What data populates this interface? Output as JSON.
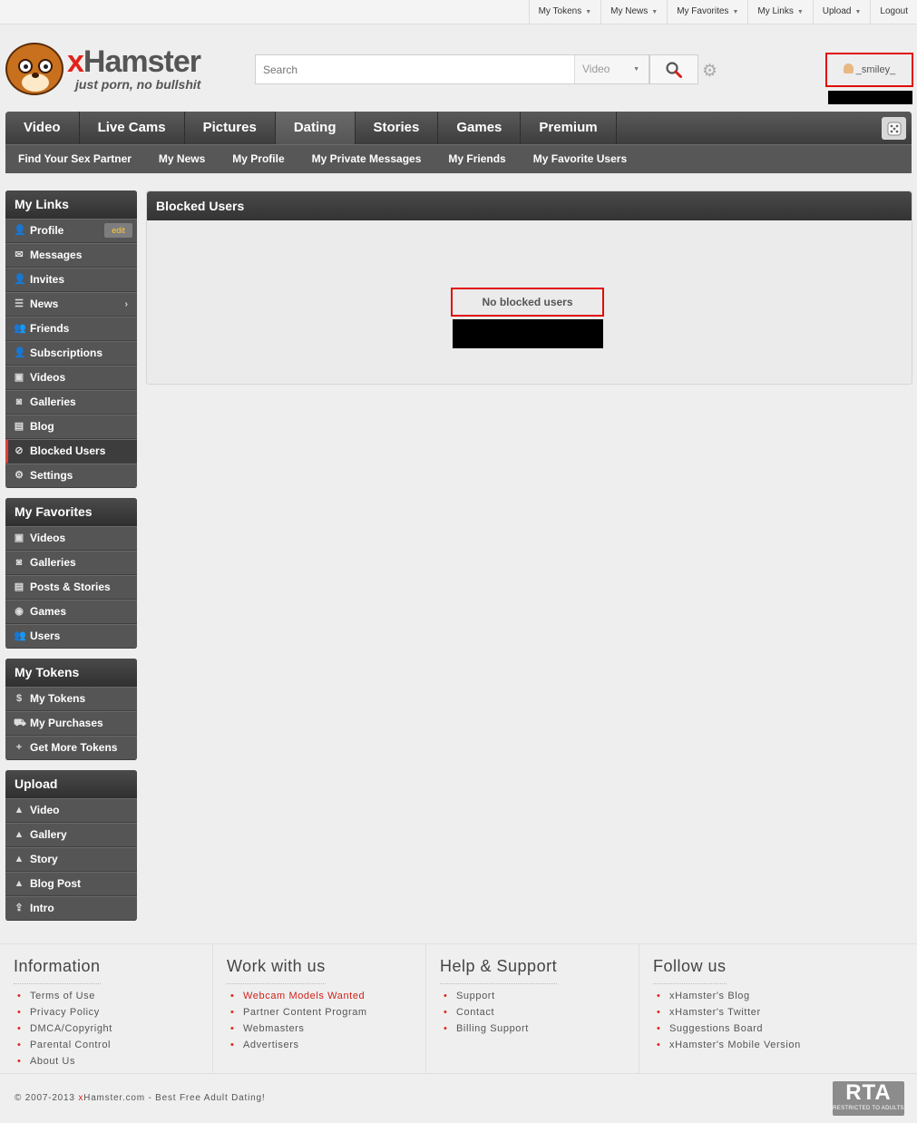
{
  "topbar": {
    "items": [
      {
        "label": "My Tokens",
        "caret": true
      },
      {
        "label": "My News",
        "caret": true
      },
      {
        "label": "My Favorites",
        "caret": true
      },
      {
        "label": "My Links",
        "caret": true
      },
      {
        "label": "Upload",
        "caret": true
      },
      {
        "label": "Logout",
        "caret": false
      }
    ]
  },
  "header": {
    "logo_x": "x",
    "logo_name": "Hamster",
    "logo_tagline": "just porn, no bullshit",
    "search_placeholder": "Search",
    "search_scope": "Video",
    "username": "_smiley_"
  },
  "mainnav": {
    "tabs": [
      "Video",
      "Live Cams",
      "Pictures",
      "Dating",
      "Stories",
      "Games",
      "Premium"
    ],
    "active_tab": "Dating",
    "subitems": [
      "Find Your Sex Partner",
      "My News",
      "My Profile",
      "My Private Messages",
      "My Friends",
      "My Favorite Users"
    ]
  },
  "sidebar": {
    "links_title": "My Links",
    "links": [
      {
        "label": "Profile",
        "icon": "user-icon",
        "edit": "edit"
      },
      {
        "label": "Messages",
        "icon": "envelope-icon"
      },
      {
        "label": "Invites",
        "icon": "user-plus-icon"
      },
      {
        "label": "News",
        "icon": "news-icon",
        "arrow": "›"
      },
      {
        "label": "Friends",
        "icon": "friends-icon"
      },
      {
        "label": "Subscriptions",
        "icon": "subscriptions-icon"
      },
      {
        "label": "Videos",
        "icon": "video-camera-icon"
      },
      {
        "label": "Galleries",
        "icon": "camera-icon"
      },
      {
        "label": "Blog",
        "icon": "blog-icon"
      },
      {
        "label": "Blocked Users",
        "icon": "block-icon",
        "active": true
      },
      {
        "label": "Settings",
        "icon": "gear-icon"
      }
    ],
    "favorites_title": "My Favorites",
    "favorites": [
      {
        "label": "Videos",
        "icon": "video-camera-icon"
      },
      {
        "label": "Galleries",
        "icon": "camera-icon"
      },
      {
        "label": "Posts & Stories",
        "icon": "posts-icon"
      },
      {
        "label": "Games",
        "icon": "gamepad-icon"
      },
      {
        "label": "Users",
        "icon": "users-icon"
      }
    ],
    "tokens_title": "My Tokens",
    "tokens": [
      {
        "label": "My Tokens",
        "icon": "token-icon"
      },
      {
        "label": "My Purchases",
        "icon": "cart-icon"
      },
      {
        "label": "Get More Tokens",
        "icon": "add-token-icon"
      }
    ],
    "upload_title": "Upload",
    "upload": [
      {
        "label": "Video",
        "icon": "upload-video-icon"
      },
      {
        "label": "Gallery",
        "icon": "upload-gallery-icon"
      },
      {
        "label": "Story",
        "icon": "upload-story-icon"
      },
      {
        "label": "Blog Post",
        "icon": "upload-blog-icon"
      },
      {
        "label": "Intro",
        "icon": "upload-intro-icon"
      }
    ]
  },
  "content": {
    "title": "Blocked Users",
    "empty_message": "No blocked users"
  },
  "footer": {
    "columns": [
      {
        "title": "Information",
        "links": [
          "Terms of Use",
          "Privacy Policy",
          "DMCA/Copyright",
          "Parental Control",
          "About Us"
        ]
      },
      {
        "title": "Work with us",
        "links": [
          "Webcam Models Wanted",
          "Partner Content Program",
          "Webmasters",
          "Advertisers"
        ],
        "highlight_first": true
      },
      {
        "title": "Help & Support",
        "links": [
          "Support",
          "Contact",
          "Billing Support"
        ]
      },
      {
        "title": "Follow us",
        "links": [
          "xHamster's Blog",
          "xHamster's Twitter",
          "Suggestions Board",
          "xHamster's Mobile Version"
        ]
      }
    ],
    "copyright_pre": "© 2007-2013 ",
    "copyright_x": "x",
    "copyright_post": "Hamster.com - Best Free Adult Dating!",
    "rta_big": "RTA",
    "rta_small": "RESTRICTED TO ADULTS"
  },
  "colors": {
    "accent": "#e2231a",
    "nav_bg": "#4a4a4a",
    "highlight_border": "#e10b0b"
  }
}
